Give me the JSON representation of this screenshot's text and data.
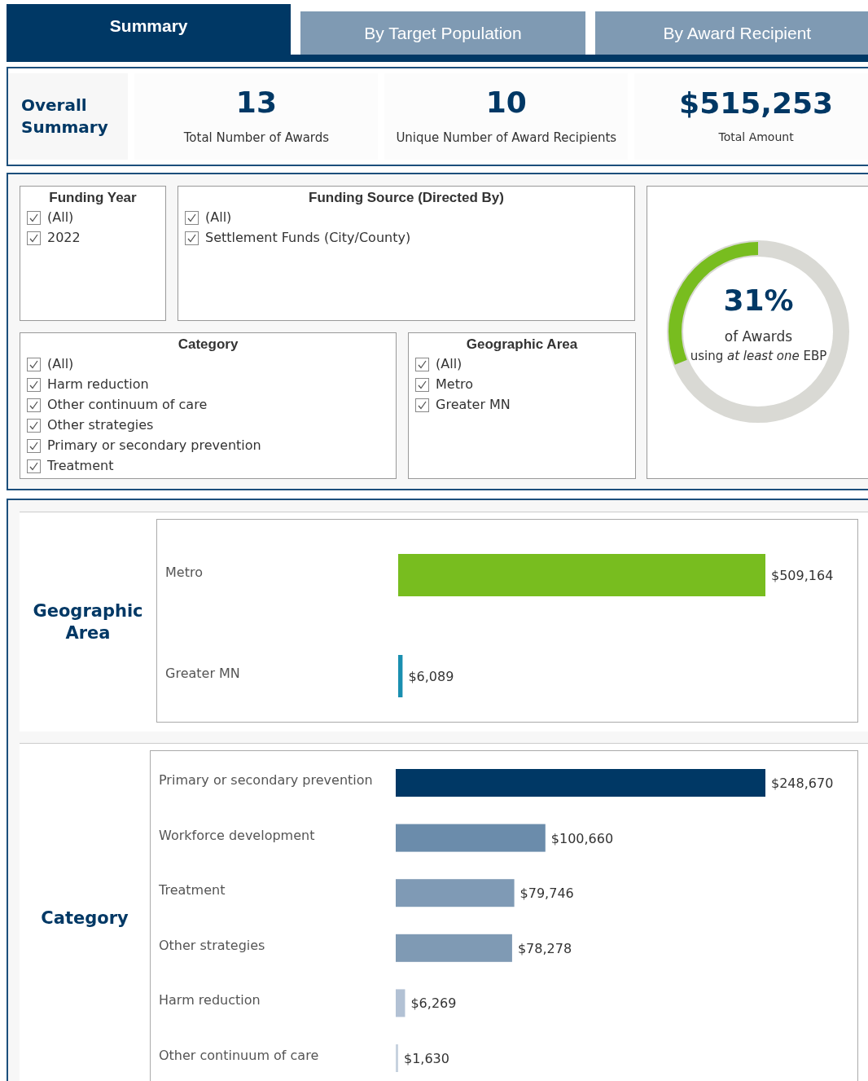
{
  "tabs": [
    {
      "label": "Summary",
      "selected": true
    },
    {
      "label": "By Target Population",
      "selected": false
    },
    {
      "label": "By Award Recipient",
      "selected": false
    }
  ],
  "overall_summary": {
    "title": "Overall Summary",
    "stats": [
      {
        "value": "13",
        "label": "Total Number of Awards"
      },
      {
        "value": "10",
        "label": "Unique Number of Award Recipients"
      },
      {
        "value": "$515,253",
        "label": "Total Amount"
      }
    ]
  },
  "filters": [
    {
      "title": "Funding Year",
      "options": [
        {
          "label": "(All)",
          "checked": true
        },
        {
          "label": "2022",
          "checked": true
        }
      ]
    },
    {
      "title": "Funding Source (Directed By)",
      "options": [
        {
          "label": "(All)",
          "checked": true
        },
        {
          "label": "Settlement Funds (City/County)",
          "checked": true
        }
      ]
    },
    {
      "title": "Category",
      "options": [
        {
          "label": "(All)",
          "checked": true
        },
        {
          "label": "Harm reduction",
          "checked": true
        },
        {
          "label": "Other continuum of care",
          "checked": true
        },
        {
          "label": "Other strategies",
          "checked": true
        },
        {
          "label": "Primary or secondary prevention",
          "checked": true
        },
        {
          "label": "Treatment",
          "checked": true
        }
      ]
    },
    {
      "title": "Geographic Area",
      "options": [
        {
          "label": "(All)",
          "checked": true
        },
        {
          "label": "Metro",
          "checked": true
        },
        {
          "label": "Greater MN",
          "checked": true
        }
      ]
    }
  ],
  "ebp_gauge": {
    "percent": "31%",
    "level": 0.31,
    "caption": "of Awards",
    "caption_2": "using *at least one* EBP"
  },
  "geographic_area": {
    "title": "Geographic Area",
    "chart_data": {
      "type": "bar",
      "orientation": "horizontal",
      "categories": [
        "Metro",
        "Greater MN"
      ],
      "series": [
        {
          "color": "#78bd1f",
          "values": [
            509164,
            null
          ],
          "value_labels": [
            "$509,164",
            null
          ]
        },
        {
          "color": "#1a8fb0",
          "values": [
            null,
            6089
          ],
          "value_labels": [
            null,
            "$6,089"
          ]
        }
      ],
      "data_labels": true
    }
  },
  "category": {
    "title": "Category",
    "chart_data": {
      "type": "bar",
      "orientation": "horizontal",
      "categories": [
        "Primary or secondary prevention",
        "Workforce development",
        "Treatment",
        "Other strategies",
        "Harm reduction",
        "Other continuum of care"
      ],
      "series": [
        {
          "color": "#003865",
          "values": [
            248670,
            null,
            null,
            null,
            null,
            null
          ],
          "value_labels": [
            "$248,670",
            null,
            null,
            null,
            null,
            null
          ]
        },
        {
          "color": "#6b8cab",
          "values": [
            null,
            100660,
            null,
            null,
            null,
            null
          ],
          "value_labels": [
            null,
            "$100,660",
            null,
            null,
            null,
            null
          ]
        },
        {
          "color": "#7f9ab5",
          "values": [
            null,
            null,
            79746,
            null,
            null,
            null
          ],
          "value_labels": [
            null,
            null,
            "$79,746",
            null,
            null,
            null
          ]
        },
        {
          "color": "#7f9ab4",
          "values": [
            null,
            null,
            null,
            78278,
            null,
            null
          ],
          "value_labels": [
            null,
            null,
            null,
            "$78,278",
            null,
            null
          ]
        },
        {
          "color": "#b2c1d4",
          "values": [
            null,
            null,
            null,
            null,
            6269,
            null
          ],
          "value_labels": [
            null,
            null,
            null,
            null,
            "$6,269",
            null
          ]
        },
        {
          "color": "#c7d2df",
          "values": [
            null,
            null,
            null,
            null,
            null,
            1630
          ],
          "value_labels": [
            null,
            null,
            null,
            null,
            null,
            "$1,630"
          ]
        }
      ],
      "data_labels": true
    }
  }
}
